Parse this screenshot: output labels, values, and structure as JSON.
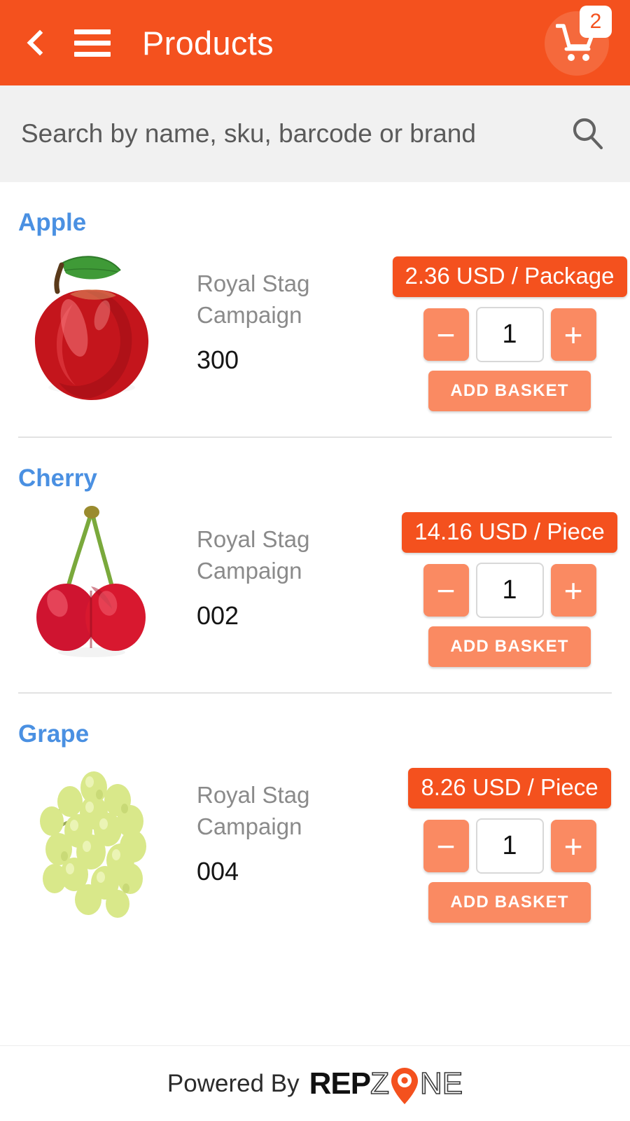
{
  "header": {
    "title": "Products",
    "back_icon": "chevron-left-icon",
    "menu_icon": "hamburger-icon",
    "cart_icon": "shopping-cart-icon",
    "cart_count": "2",
    "bg_color": "#F4511E"
  },
  "search": {
    "placeholder": "Search by name, sku, barcode or brand",
    "value": "",
    "icon": "search-icon",
    "bg_color": "#F1F1F1"
  },
  "colors": {
    "accent": "#F4511E",
    "accent_light": "#FA8A62",
    "title_blue": "#4A90E2",
    "desc_gray": "#8A8A8A"
  },
  "products": [
    {
      "name": "Apple",
      "brand": "Royal Stag",
      "campaign": "Campaign",
      "sku": "300",
      "price": "2.36 USD / Package",
      "quantity": "1",
      "minus_label": "−",
      "plus_label": "+",
      "add_label": "ADD BASKET",
      "image": "apple-image"
    },
    {
      "name": "Cherry",
      "brand": "Royal Stag",
      "campaign": "Campaign",
      "sku": "002",
      "price": "14.16 USD / Piece",
      "quantity": "1",
      "minus_label": "−",
      "plus_label": "+",
      "add_label": "ADD BASKET",
      "image": "cherry-image"
    },
    {
      "name": "Grape",
      "brand": "Royal Stag",
      "campaign": "Campaign",
      "sku": "004",
      "price": "8.26 USD / Piece",
      "quantity": "1",
      "minus_label": "−",
      "plus_label": "+",
      "add_label": "ADD BASKET",
      "image": "grape-image"
    }
  ],
  "footer": {
    "powered_by": "Powered By",
    "logo_rep": "REP",
    "logo_z": "Z",
    "logo_ne": "NE",
    "logo_pin_icon": "map-pin-icon"
  }
}
